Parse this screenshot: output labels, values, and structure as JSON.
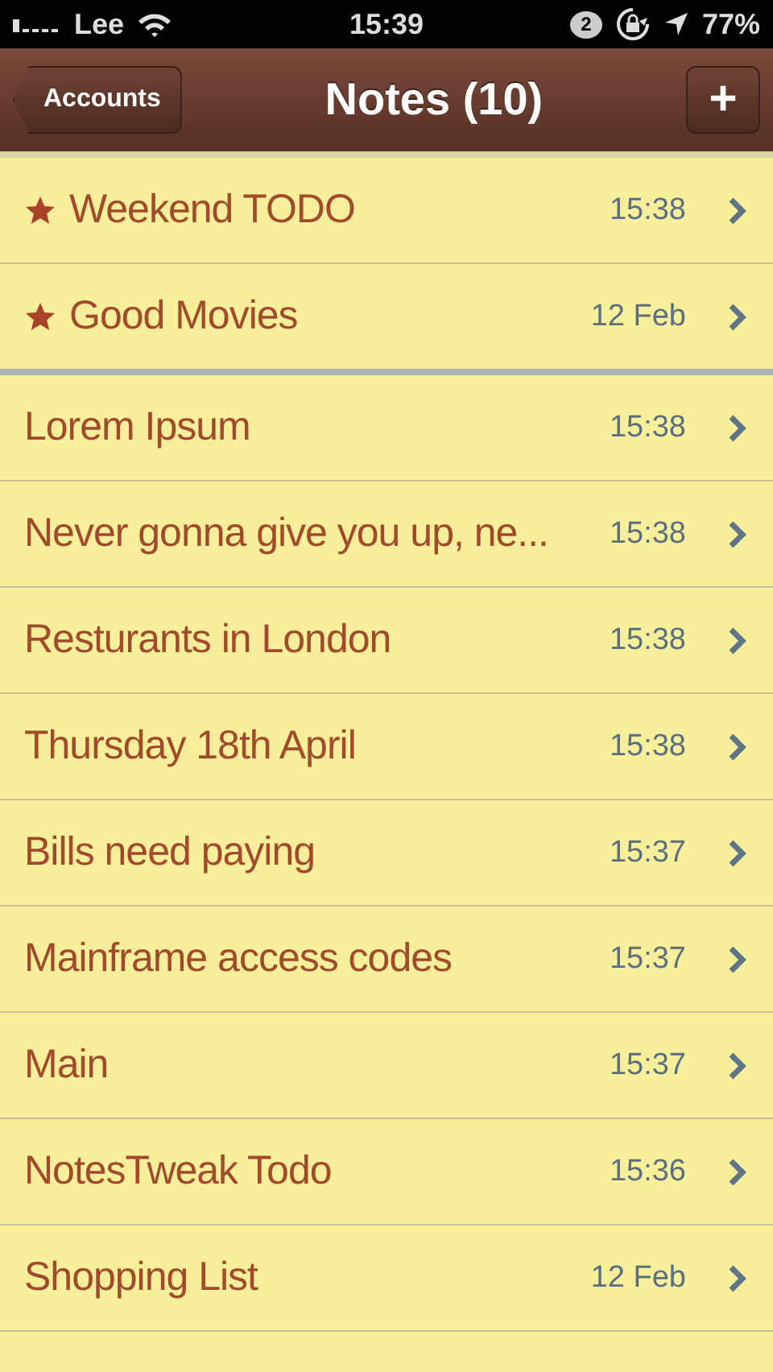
{
  "status_bar": {
    "carrier": "Lee",
    "time": "15:39",
    "notification_count": "2",
    "battery": "77%"
  },
  "nav_bar": {
    "back_button": "Accounts",
    "title": "Notes (10)",
    "add_button": "+"
  },
  "sections": [
    {
      "notes": [
        {
          "title": "Weekend TODO",
          "time": "15:38",
          "starred": true
        },
        {
          "title": "Good Movies",
          "time": "12 Feb",
          "starred": true
        }
      ]
    },
    {
      "notes": [
        {
          "title": "Lorem Ipsum",
          "time": "15:38",
          "starred": false
        },
        {
          "title": "Never gonna give you up, ne...",
          "time": "15:38",
          "starred": false
        },
        {
          "title": "Resturants in London",
          "time": "15:38",
          "starred": false
        },
        {
          "title": "Thursday 18th April",
          "time": "15:38",
          "starred": false
        },
        {
          "title": "Bills need paying",
          "time": "15:37",
          "starred": false
        },
        {
          "title": "Mainframe access codes",
          "time": "15:37",
          "starred": false
        },
        {
          "title": "Main",
          "time": "15:37",
          "starred": false
        },
        {
          "title": "NotesTweak Todo",
          "time": "15:36",
          "starred": false
        },
        {
          "title": "Shopping List",
          "time": "12 Feb",
          "starred": false
        }
      ]
    }
  ]
}
